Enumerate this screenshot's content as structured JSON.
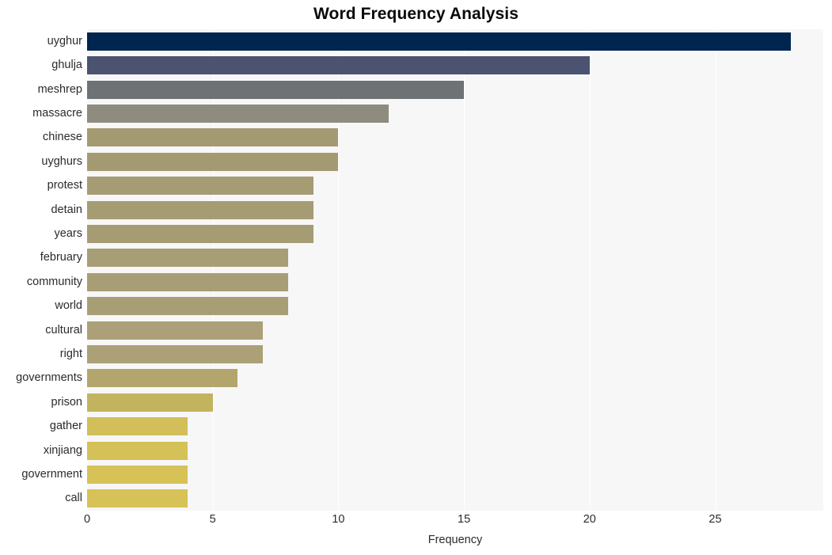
{
  "chart_data": {
    "type": "bar",
    "orientation": "horizontal",
    "title": "Word Frequency Analysis",
    "xlabel": "Frequency",
    "ylabel": "",
    "categories": [
      "uyghur",
      "ghulja",
      "meshrep",
      "massacre",
      "chinese",
      "uyghurs",
      "protest",
      "detain",
      "years",
      "february",
      "community",
      "world",
      "cultural",
      "right",
      "governments",
      "prison",
      "gather",
      "xinjiang",
      "government",
      "call"
    ],
    "values": [
      28,
      20,
      15,
      12,
      10,
      10,
      9,
      9,
      9,
      8,
      8,
      8,
      7,
      7,
      6,
      5,
      4,
      4,
      4,
      4
    ],
    "xlim": [
      0,
      29.3
    ],
    "xticks": [
      0,
      5,
      10,
      15,
      20,
      25
    ],
    "xtick_labels": [
      "0",
      "5",
      "10",
      "15",
      "20",
      "25"
    ],
    "grid": true,
    "grid_axis": "x",
    "legend": false,
    "bar_colors": [
      "#00254f",
      "#4c5370",
      "#6f7274",
      "#8e8c7e",
      "#a49a72",
      "#a49a72",
      "#a69c74",
      "#a69c74",
      "#a69c74",
      "#a89e75",
      "#a89e75",
      "#a89e75",
      "#aba077",
      "#aba077",
      "#b3a66d",
      "#c2b45f",
      "#d2bf59",
      "#d4c157",
      "#d6c257",
      "#d6c257"
    ]
  },
  "style": {
    "plot_background": "#f7f7f7",
    "figure_background": "#ffffff",
    "gridline_color": "#ffffff",
    "text_color": "#2b2b2b",
    "title_color": "#0a0a0a"
  }
}
